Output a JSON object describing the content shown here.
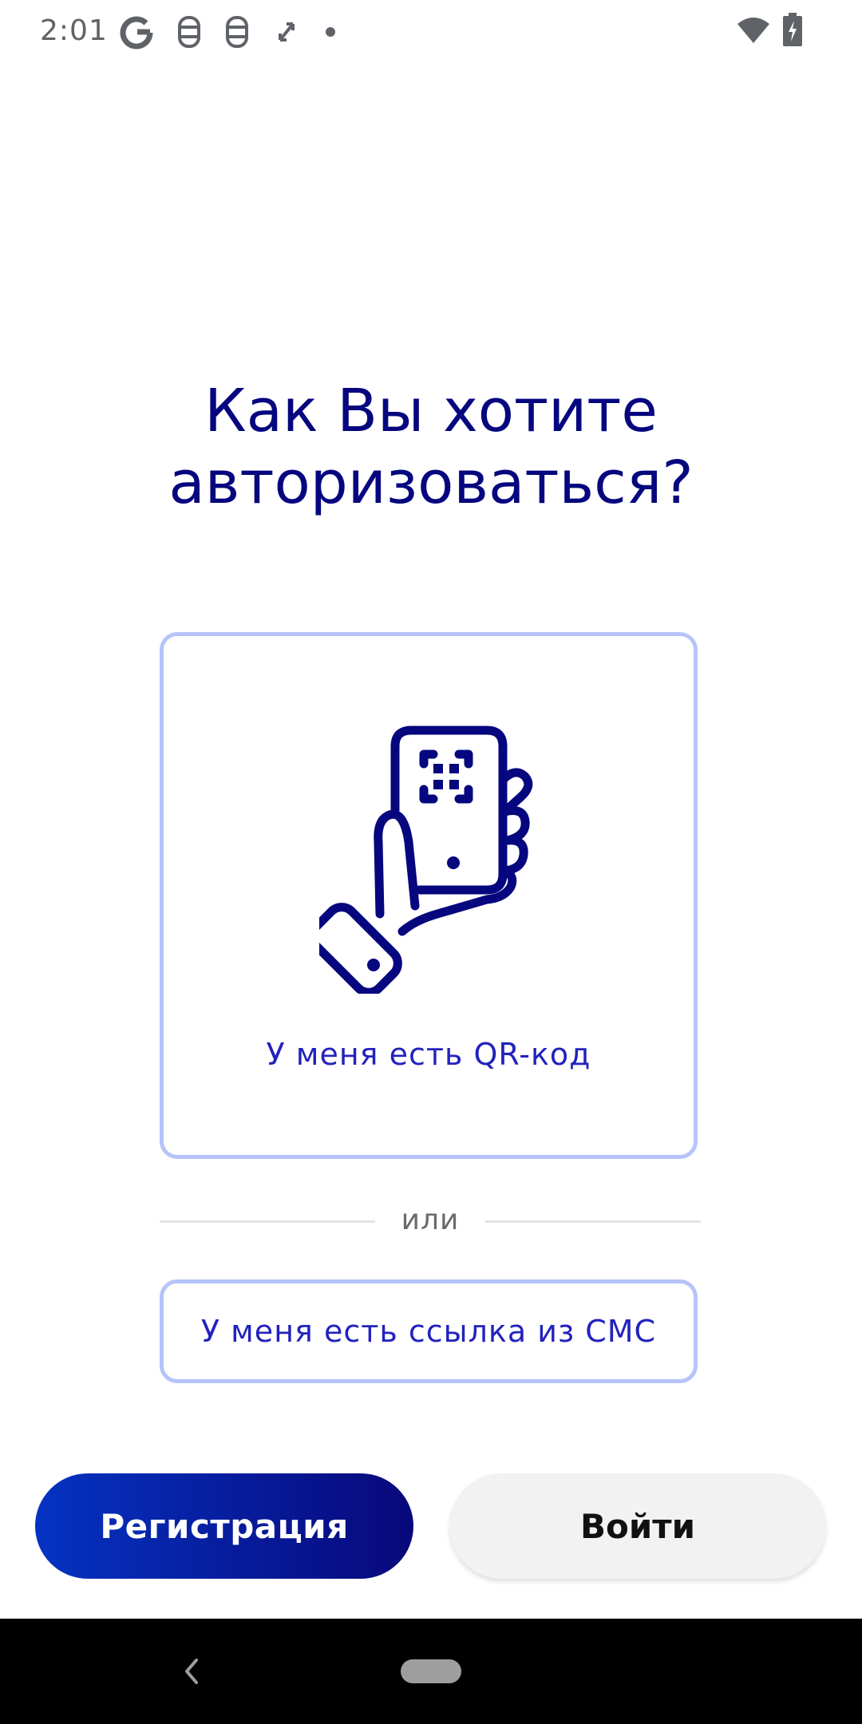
{
  "status_bar": {
    "time": "2:01",
    "icons": [
      "google-icon",
      "notification-icon",
      "notification-icon",
      "sync-icon",
      "dot-icon",
      "wifi-icon",
      "battery-charging-icon"
    ]
  },
  "main": {
    "title": "Как Вы хотите\nавторизоваться?",
    "qr_option": {
      "label": "У меня есть QR-код",
      "icon": "hand-phone-qr-icon"
    },
    "divider_text": "или",
    "sms_option": {
      "label": "У меня есть ссылка из СМС"
    }
  },
  "actions": {
    "register_label": "Регистрация",
    "login_label": "Войти"
  },
  "colors": {
    "primary": "#06067f",
    "link": "#2222bd",
    "card_border": "#b6c4fa",
    "register_gradient_start": "#0533c2",
    "register_gradient_end": "#08087a"
  },
  "nav_bar": {
    "icons": [
      "back-icon",
      "home-icon"
    ]
  }
}
